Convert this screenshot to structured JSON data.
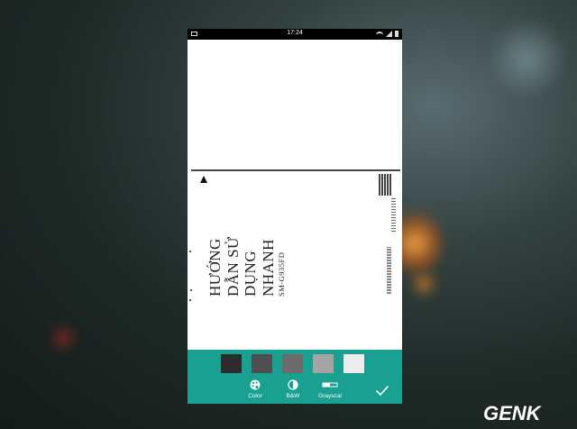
{
  "status_bar": {
    "time": "17:24"
  },
  "document": {
    "heading_lines": [
      "HƯỚNG",
      "DẪN SỬ",
      "DỤNG",
      "NHANH"
    ],
    "model": "SM-G935FD"
  },
  "toolbar": {
    "swatches": [
      {
        "name": "swatch-dark",
        "color": "#2c2c2c"
      },
      {
        "name": "swatch-darkgray",
        "color": "#4f4f4f"
      },
      {
        "name": "swatch-gray",
        "color": "#6b6b6b"
      },
      {
        "name": "swatch-lightgray",
        "color": "#a4a4a4"
      },
      {
        "name": "swatch-white",
        "color": "#ececec"
      }
    ],
    "modes": {
      "color_label": "Color",
      "bw_label": "B&W",
      "grayscale_label": "Grayscal"
    },
    "accent_color": "#19a090"
  },
  "watermark": {
    "text": "GENK"
  }
}
